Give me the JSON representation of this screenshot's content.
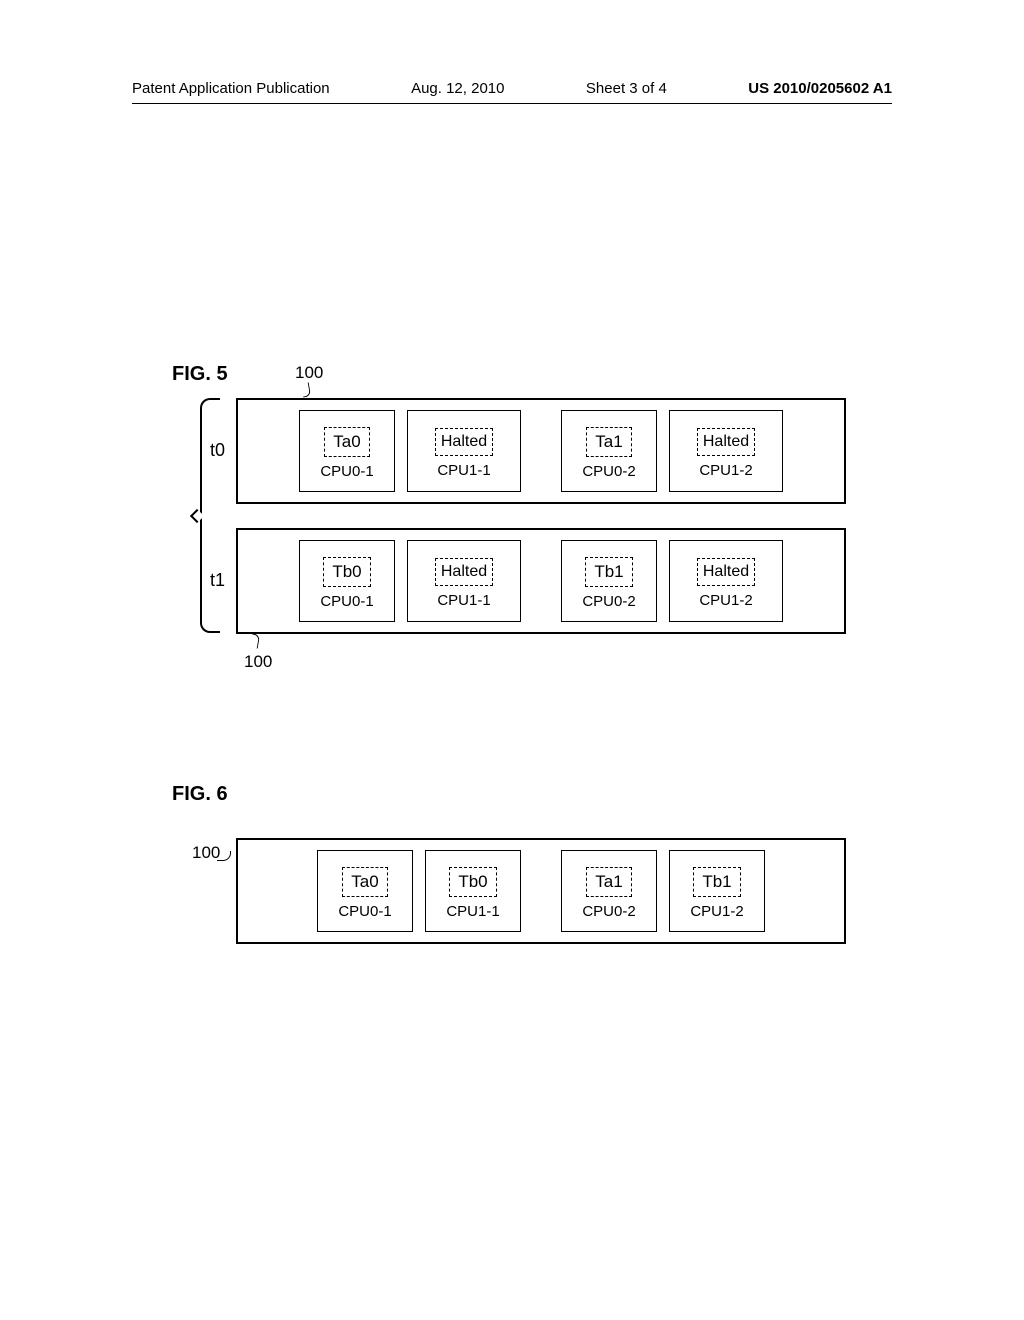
{
  "header": {
    "publication_label": "Patent Application Publication",
    "date": "Aug. 12, 2010",
    "sheet": "Sheet 3 of 4",
    "pubno": "US 2010/0205602 A1"
  },
  "fig5": {
    "label": "FIG. 5",
    "ref_top": "100",
    "ref_bot": "100",
    "times": {
      "t0": "t0",
      "t1": "t1"
    },
    "row1": {
      "cpu0_1": {
        "task": "Ta0",
        "label": "CPU0-1"
      },
      "cpu1_1": {
        "task": "Halted",
        "label": "CPU1-1"
      },
      "cpu0_2": {
        "task": "Ta1",
        "label": "CPU0-2"
      },
      "cpu1_2": {
        "task": "Halted",
        "label": "CPU1-2"
      }
    },
    "row2": {
      "cpu0_1": {
        "task": "Tb0",
        "label": "CPU0-1"
      },
      "cpu1_1": {
        "task": "Halted",
        "label": "CPU1-1"
      },
      "cpu0_2": {
        "task": "Tb1",
        "label": "CPU0-2"
      },
      "cpu1_2": {
        "task": "Halted",
        "label": "CPU1-2"
      }
    }
  },
  "fig6": {
    "label": "FIG. 6",
    "ref": "100",
    "row": {
      "cpu0_1": {
        "task": "Ta0",
        "label": "CPU0-1"
      },
      "cpu1_1": {
        "task": "Tb0",
        "label": "CPU1-1"
      },
      "cpu0_2": {
        "task": "Ta1",
        "label": "CPU0-2"
      },
      "cpu1_2": {
        "task": "Tb1",
        "label": "CPU1-2"
      }
    }
  }
}
